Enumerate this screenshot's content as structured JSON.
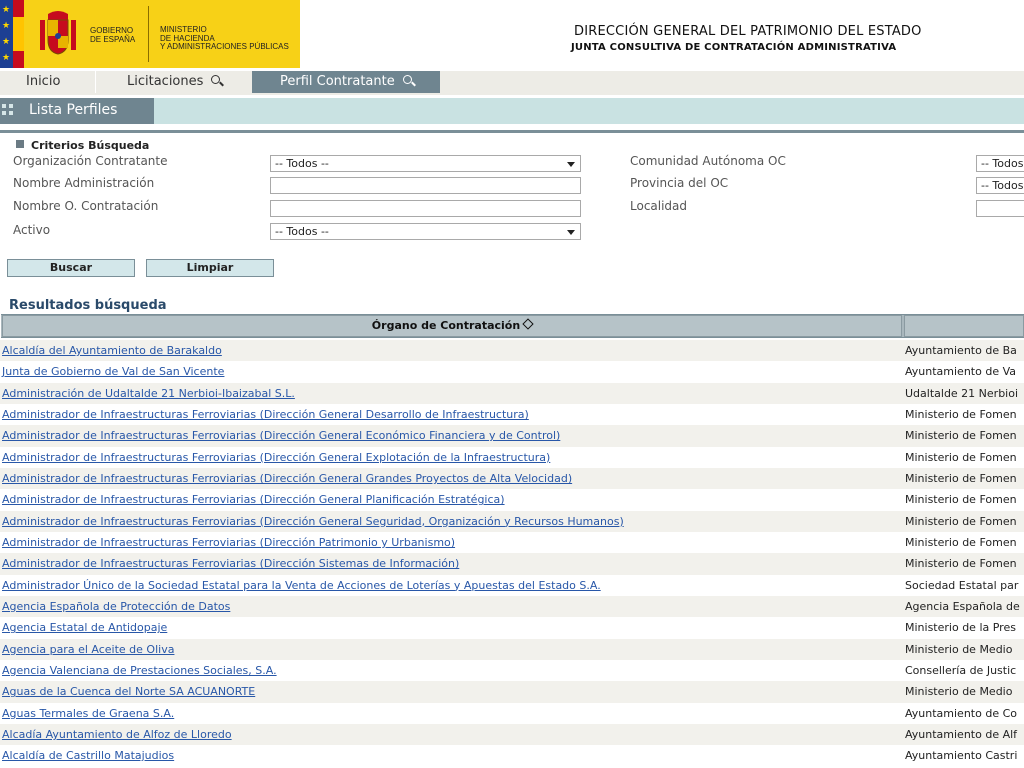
{
  "header": {
    "gov_text": "GOBIERNO\nDE ESPAÑA",
    "ministry_text": "MINISTERIO\nDE HACIENDA\nY ADMINISTRACIONES PÚBLICAS",
    "title": "DIRECCIÓN GENERAL DEL PATRIMONIO DEL ESTADO",
    "subtitle": "JUNTA CONSULTIVA DE CONTRATACIÓN ADMINISTRATIVA"
  },
  "nav": {
    "inicio": "Inicio",
    "licitaciones": "Licitaciones",
    "perfil": "Perfil Contratante"
  },
  "section": {
    "title": "Lista Perfiles"
  },
  "criteria": {
    "title": "Criterios Búsqueda",
    "org_label": "Organización Contratante",
    "org_value": "-- Todos --",
    "admin_label": "Nombre Administración",
    "admin_value": "",
    "oc_label": "Nombre O. Contratación",
    "oc_value": "",
    "activo_label": "Activo",
    "activo_value": "-- Todos --",
    "ccaa_label": "Comunidad Autónoma OC",
    "ccaa_value": "-- Todos",
    "prov_label": "Provincia del OC",
    "prov_value": "-- Todos",
    "loc_label": "Localidad",
    "loc_value": ""
  },
  "buttons": {
    "buscar": "Buscar",
    "limpiar": "Limpiar"
  },
  "results": {
    "title": "Resultados búsqueda",
    "col_organo": "Órgano de Contratación",
    "rows": [
      [
        "Alcaldía del Ayuntamiento de Barakaldo",
        "Ayuntamiento de Ba"
      ],
      [
        "Junta de Gobierno de Val de San Vicente",
        "Ayuntamiento de Va"
      ],
      [
        "Administración de Udaltalde 21 Nerbioi-Ibaizabal S.L.",
        "Udaltalde 21 Nerbioi"
      ],
      [
        "Administrador de Infraestructuras Ferroviarias (Dirección General Desarrollo de Infraestructura)",
        "Ministerio de Fomen"
      ],
      [
        "Administrador de Infraestructuras Ferroviarias (Dirección General Económico Financiera y de Control)",
        "Ministerio de Fomen"
      ],
      [
        "Administrador de Infraestructuras Ferroviarias (Dirección General Explotación de la Infraestructura)",
        "Ministerio de Fomen"
      ],
      [
        "Administrador de Infraestructuras Ferroviarias (Dirección General Grandes Proyectos de Alta Velocidad)",
        "Ministerio de Fomen"
      ],
      [
        "Administrador de Infraestructuras Ferroviarias (Dirección General Planificación Estratégica)",
        "Ministerio de Fomen"
      ],
      [
        "Administrador de Infraestructuras Ferroviarias (Dirección General Seguridad, Organización y Recursos Humanos)",
        "Ministerio de Fomen"
      ],
      [
        "Administrador de Infraestructuras Ferroviarias (Dirección Patrimonio y Urbanismo)",
        "Ministerio de Fomen"
      ],
      [
        "Administrador de Infraestructuras Ferroviarias (Dirección Sistemas de Información)",
        "Ministerio de Fomen"
      ],
      [
        "Administrador Único de la Sociedad Estatal para la Venta de Acciones de Loterías y Apuestas del Estado S.A.",
        "Sociedad Estatal par"
      ],
      [
        "Agencia Española de Protección de Datos",
        "Agencia Española de"
      ],
      [
        "Agencia Estatal de Antidopaje",
        "Ministerio de la Pres"
      ],
      [
        "Agencia para el Aceite de Oliva",
        "Ministerio de Medio"
      ],
      [
        "Agencia Valenciana de Prestaciones Sociales, S.A.",
        "Consellería de Justic"
      ],
      [
        "Aguas de la Cuenca del Norte SA ACUANORTE",
        "Ministerio de Medio"
      ],
      [
        "Aguas Termales de Graena S.A.",
        "Ayuntamiento de Co"
      ],
      [
        "Alcadía Ayuntamiento de Alfoz de Lloredo",
        "Ayuntamiento de Alf"
      ],
      [
        "Alcaldía de Castrillo Matajudios",
        "Ayuntamiento Castri"
      ]
    ]
  }
}
